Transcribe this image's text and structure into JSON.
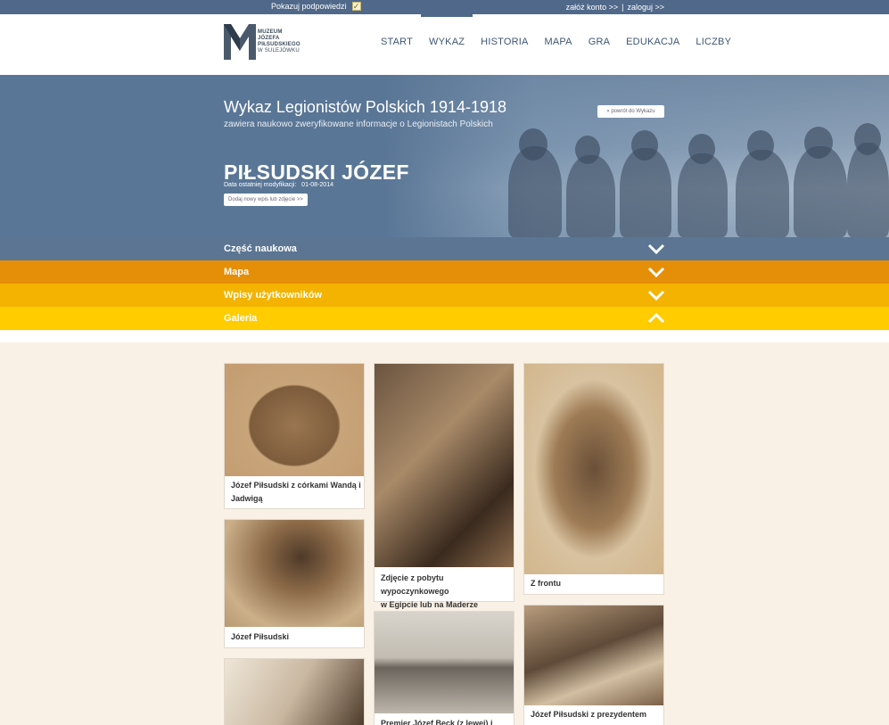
{
  "topbar": {
    "hints_label": "Pokazuj podpowiedzi",
    "hints_checked": true,
    "register": "załóż konto >>",
    "separator": "|",
    "login": "zaloguj >>"
  },
  "logo": {
    "line1": "MUZEUM",
    "line2": "JÓZEFA",
    "line3": "PIŁSUDSKIEGO",
    "line4": "W SULEJÓWKU"
  },
  "nav": {
    "items": [
      {
        "label": "START"
      },
      {
        "label": "WYKAZ",
        "active": true
      },
      {
        "label": "HISTORIA"
      },
      {
        "label": "MAPA"
      },
      {
        "label": "GRA"
      },
      {
        "label": "EDUKACJA"
      },
      {
        "label": "LICZBY"
      }
    ]
  },
  "hero": {
    "title": "Wykaz Legionistów Polskich 1914-1918",
    "subtitle": "zawiera naukowo zweryfikowane informacje o Legionistach Polskich",
    "back_button": "« powrót do Wykazu",
    "person_name": "PIŁSUDSKI JÓZEF",
    "modified_label": "Data ostatniej modyfikacji:",
    "modified_date": "01-08-2014",
    "add_button": "Dodaj nowy wpis lub zdjęcie >>"
  },
  "accordion": {
    "sections": [
      {
        "label": "Część naukowa",
        "expanded": false,
        "color": "#5b7593"
      },
      {
        "label": "Mapa",
        "expanded": false,
        "color": "#e58e07"
      },
      {
        "label": "Wpisy użytkowników",
        "expanded": false,
        "color": "#f3b300"
      },
      {
        "label": "Galeria",
        "expanded": true,
        "color": "#ffcc00"
      }
    ]
  },
  "gallery": {
    "items": [
      {
        "caption_line1": "Józef Piłsudski z córkami Wandą i",
        "caption_line2": "Jadwigą"
      },
      {
        "caption_line1": "Zdjęcie z pobytu wypoczynkowego",
        "caption_line2": "w Egipcie lub na Maderze"
      },
      {
        "caption_line1": "Z frontu",
        "caption_line2": ""
      },
      {
        "caption_line1": "Józef Piłsudski",
        "caption_line2": ""
      },
      {
        "caption_line1": "Premier Józef Beck (z lewej) i",
        "caption_line2": ""
      },
      {
        "caption_line1": "Józef Piłsudski z prezydentem",
        "caption_line2": ""
      },
      {
        "caption_line1": "",
        "caption_line2": ""
      }
    ]
  }
}
